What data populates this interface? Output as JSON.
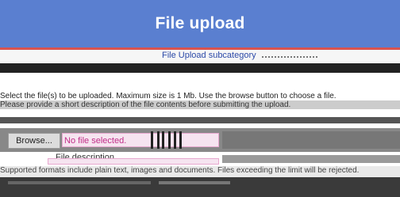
{
  "header": {
    "title": "File upload",
    "background_color": "#5a7fd0",
    "accent_color": "#d9534f"
  },
  "subtitle": "File Upload subcategory",
  "instructions": {
    "line1": "Select the file(s) to be uploaded. Maximum size is 1 Mb. Use the browse button to choose a file.",
    "line2": "Please provide a short description of the file contents before submitting the upload."
  },
  "file_input": {
    "button_label": "Browse...",
    "status_text": "No file selected.",
    "status_color": "#c02e88"
  },
  "description": {
    "label": "File description"
  },
  "footer": {
    "text": "Supported formats include plain text, images and documents. Files exceeding the limit will be rejected."
  }
}
